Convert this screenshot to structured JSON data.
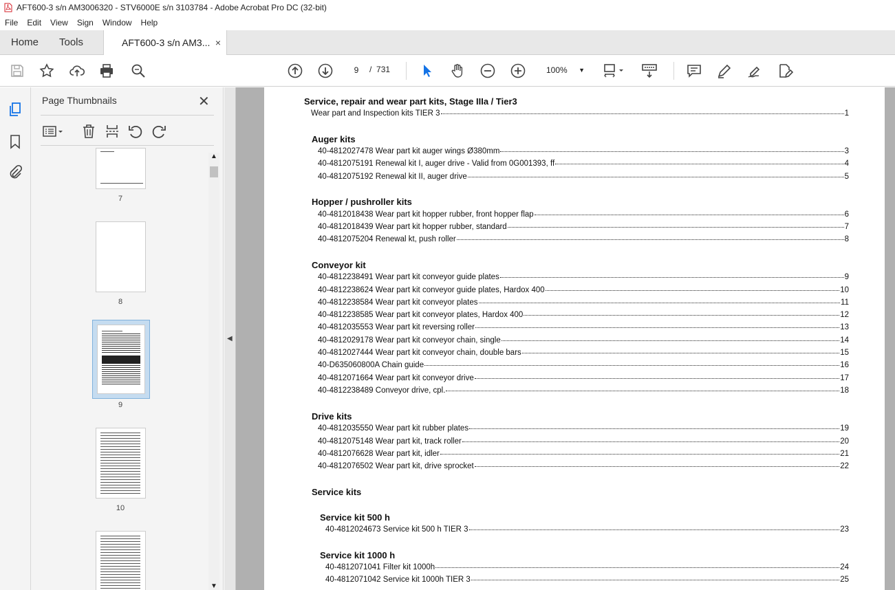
{
  "window": {
    "title": "AFT600-3 s/n AM3006320 - STV6000E s/n 3103784 - Adobe Acrobat Pro DC (32-bit)"
  },
  "menu": [
    "File",
    "Edit",
    "View",
    "Sign",
    "Window",
    "Help"
  ],
  "tabs": {
    "home": "Home",
    "tools": "Tools",
    "doc": "AFT600-3 s/n AM3...",
    "close": "×"
  },
  "toolbar": {
    "page_current": "9",
    "page_sep": "/",
    "page_total": "731",
    "zoom": "100%"
  },
  "panel": {
    "title": "Page Thumbnails",
    "close": "✕",
    "thumbs": [
      "7",
      "8",
      "9",
      "10"
    ]
  },
  "doc": {
    "title": "Service, repair and wear part kits, Stage IIIa / Tier3",
    "intro": {
      "text": "Wear part and Inspection kits TIER 3",
      "page": "1"
    },
    "sections": [
      {
        "heading": "Auger kits",
        "items": [
          {
            "text": "40-4812027478 Wear part kit auger wings Ø380mm",
            "page": "3"
          },
          {
            "text": "40-4812075191 Renewal kit I, auger drive - Valid from 0G001393, ff",
            "page": "4"
          },
          {
            "text": "40-4812075192 Renewal kit II, auger drive",
            "page": "5"
          }
        ]
      },
      {
        "heading": "Hopper / pushroller kits",
        "items": [
          {
            "text": "40-4812018438 Wear part kit hopper rubber, front hopper flap",
            "page": "6"
          },
          {
            "text": "40-4812018439 Wear part kit hopper rubber, standard",
            "page": "7"
          },
          {
            "text": "40-4812075204 Renewal kt, push roller",
            "page": "8"
          }
        ]
      },
      {
        "heading": "Conveyor kit",
        "items": [
          {
            "text": "40-4812238491 Wear part kit conveyor guide plates",
            "page": "9"
          },
          {
            "text": "40-4812238624 Wear part kit conveyor guide plates, Hardox 400",
            "page": "10"
          },
          {
            "text": "40-4812238584 Wear part kit conveyor plates",
            "page": "11"
          },
          {
            "text": "40-4812238585 Wear part kit conveyor plates, Hardox 400",
            "page": "12"
          },
          {
            "text": "40-4812035553 Wear part kit reversing roller",
            "page": "13"
          },
          {
            "text": "40-4812029178 Wear part kit conveyor chain, single",
            "page": "14"
          },
          {
            "text": "40-4812027444 Wear part kit conveyor chain, double bars",
            "page": "15"
          },
          {
            "text": "40-D635060800A Chain guide",
            "page": "16"
          },
          {
            "text": "40-4812071664 Wear part kit conveyor drive",
            "page": "17"
          },
          {
            "text": "40-4812238489 Conveyor drive, cpl.",
            "page": "18"
          }
        ]
      },
      {
        "heading": "Drive kits",
        "items": [
          {
            "text": "40-4812035550 Wear part kit rubber plates",
            "page": "19"
          },
          {
            "text": "40-4812075148 Wear part kit, track roller",
            "page": "20"
          },
          {
            "text": "40-4812076628 Wear part kit, idler",
            "page": "21"
          },
          {
            "text": "40-4812076502 Wear part kit, drive sprocket",
            "page": "22"
          }
        ]
      }
    ],
    "service": {
      "heading": "Service kits",
      "k500": {
        "heading": "Service kit 500 h",
        "items": [
          {
            "text": "40-4812024673 Service kit 500 h TIER 3",
            "page": "23"
          }
        ]
      },
      "k1000": {
        "heading": "Service kit 1000 h",
        "items": [
          {
            "text": "40-4812071041 Filter kit 1000h",
            "page": "24"
          },
          {
            "text": "40-4812071042 Service kit 1000h TIER 3",
            "page": "25"
          }
        ]
      }
    }
  }
}
